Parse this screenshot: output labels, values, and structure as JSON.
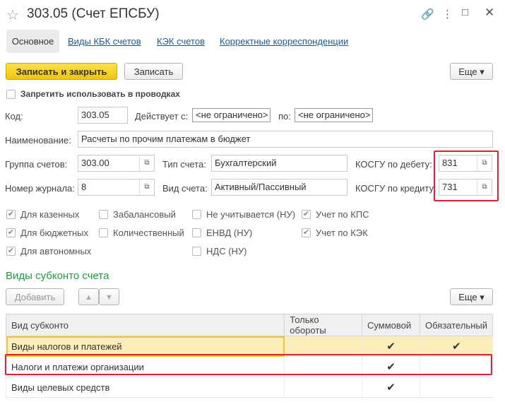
{
  "window": {
    "title": "303.05 (Счет ЕПСБУ)"
  },
  "tabs": [
    {
      "label": "Основное"
    },
    {
      "label": "Виды КБК счетов"
    },
    {
      "label": "КЭК счетов"
    },
    {
      "label": "Корректные корреспонденции"
    }
  ],
  "toolbar": {
    "save_close": "Записать и закрыть",
    "save": "Записать",
    "more": "Еще"
  },
  "form": {
    "forbid_label": "Запретить использовать в проводках",
    "code_label": "Код:",
    "code_value": "303.05",
    "valid_from_label": "Действует с:",
    "valid_from_value": "<не ограничено>",
    "valid_to_label": "по:",
    "valid_to_value": "<не ограничено>",
    "name_label": "Наименование:",
    "name_value": "Расчеты по прочим платежам в бюджет",
    "group_label": "Группа счетов:",
    "group_value": "303.00",
    "account_type_label": "Тип счета:",
    "account_type_value": "Бухгалтерский",
    "kosgu_debit_label": "КОСГУ по дебету:",
    "kosgu_debit_value": "831",
    "journal_label": "Номер журнала:",
    "journal_value": "8",
    "account_kind_label": "Вид счета:",
    "account_kind_value": "Активный/Пассивный",
    "kosgu_credit_label": "КОСГУ по кредиту:",
    "kosgu_credit_value": "731"
  },
  "checkboxes": {
    "c1": {
      "label": "Для казенных",
      "checked": true
    },
    "c2": {
      "label": "Для бюджетных",
      "checked": true
    },
    "c3": {
      "label": "Для автономных",
      "checked": true
    },
    "c4": {
      "label": "Забалансовый",
      "checked": false
    },
    "c5": {
      "label": "Количественный",
      "checked": false
    },
    "c6": {
      "label": "Не учитывается (НУ)",
      "checked": false
    },
    "c7": {
      "label": "ЕНВД (НУ)",
      "checked": false
    },
    "c8": {
      "label": "НДС (НУ)",
      "checked": false
    },
    "c9": {
      "label": "Учет по КПС",
      "checked": true
    },
    "c10": {
      "label": "Учет по КЭК",
      "checked": true
    }
  },
  "subconto": {
    "title": "Виды субконто счета",
    "add": "Добавить",
    "more": "Еще",
    "columns": [
      "Вид субконто",
      "Только обороты",
      "Суммовой",
      "Обязательный"
    ],
    "rows": [
      {
        "name": "Виды налогов и платежей",
        "turnover": "",
        "sum": "✔",
        "required": "✔"
      },
      {
        "name": "Налоги и платежи организации",
        "turnover": "",
        "sum": "✔",
        "required": ""
      },
      {
        "name": "Виды целевых средств",
        "turnover": "",
        "sum": "✔",
        "required": ""
      }
    ]
  },
  "icons": {
    "check": "✔",
    "pick": "⧉",
    "up": "▲",
    "down": "▼",
    "caret": "▾",
    "star": "☆"
  }
}
